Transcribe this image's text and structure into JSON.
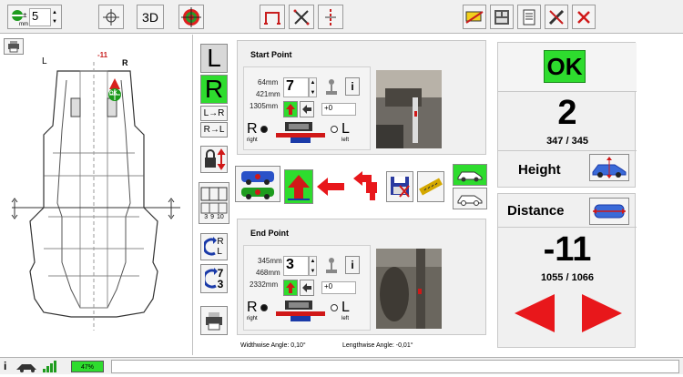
{
  "toolbar": {
    "step_value": "5",
    "btn_3d": "3D",
    "icons": [
      "step-size-icon",
      "crosshair-icon",
      "3d-view",
      "target-icon",
      "measure-bracket-icon",
      "x-cross-icon",
      "center-line-icon",
      "clear-tool-icon",
      "print-preview-icon",
      "report-icon",
      "tools-icon",
      "close-icon"
    ]
  },
  "side": {
    "L": "L",
    "R": "R",
    "lr": "L→R",
    "rl": "R→L",
    "num_r": "R",
    "num_l": "L",
    "num_7": "7",
    "num_3": "3"
  },
  "diagram": {
    "label_L": "L",
    "label_R": "R",
    "ok_label": "OK",
    "marker_value": "-11",
    "grid_labels": [
      "3",
      "9",
      "10"
    ]
  },
  "start_point": {
    "title": "Start Point",
    "dim1": "64mm",
    "dim2": "421mm",
    "dim3": "1305mm",
    "value": "7",
    "offset": "+0",
    "right_label": "R",
    "right_sub": "right",
    "left_label": "L",
    "left_sub": "left",
    "info": "i"
  },
  "end_point": {
    "title": "End Point",
    "dim1": "345mm",
    "dim2": "468mm",
    "dim3": "2332mm",
    "value": "3",
    "offset": "+0",
    "right_label": "R",
    "right_sub": "right",
    "left_label": "L",
    "left_sub": "left",
    "info": "i"
  },
  "angles": {
    "widthwise": "Widthwise Angle: 0,10°",
    "lengthwise": "Lengthwise Angle: -0,01°"
  },
  "right_panel": {
    "ok": "OK",
    "height_value": "2",
    "height_ratio": "347  /  345",
    "height_label": "Height",
    "distance_label": "Distance",
    "distance_value": "-11",
    "distance_ratio": "1055  /  1066"
  },
  "statusbar": {
    "info": "i",
    "battery": "47%"
  },
  "colors": {
    "accent_green": "#2edc2e",
    "arrow_red": "#e8171b",
    "panel_bg": "#f0f0f0"
  }
}
